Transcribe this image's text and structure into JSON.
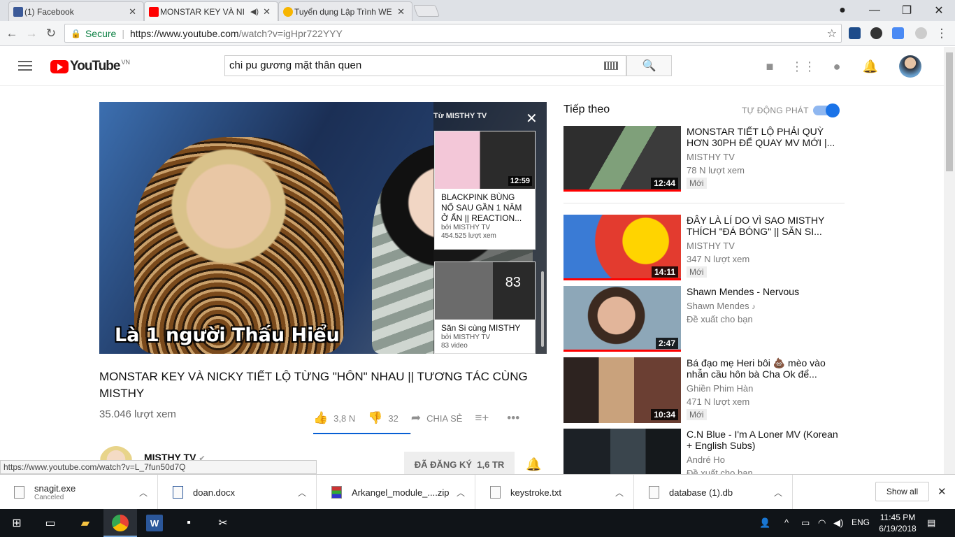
{
  "browser": {
    "tabs": [
      {
        "title": "(1) Facebook",
        "favicon_color": "#3b5998",
        "active": false
      },
      {
        "title": "MONSTAR KEY VÀ NI",
        "favicon_color": "#ff0000",
        "active": true
      },
      {
        "title": "Tuyển dụng Lập Trình WE",
        "favicon_color": "#f7b500",
        "active": false
      }
    ],
    "secure_label": "Secure",
    "url_host": "https://www.youtube.com",
    "url_path": "/watch?v=igHpr722YYY",
    "status_url": "https://www.youtube.com/watch?v=L_7fun50d7Q"
  },
  "youtube": {
    "logo_text": "YouTube",
    "country_code": "VN",
    "search_query": "chi pu gương mặt thân quen",
    "video": {
      "caption": "Là 1 người Thấu Hiểu",
      "title": "MONSTAR KEY VÀ NICKY TIẾT LỘ TỪNG \"HÔN\" NHAU || TƯƠNG TÁC CÙNG MISTHY",
      "views": "35.046 lượt xem",
      "likes": "3,8 N",
      "dislikes": "32",
      "share_label": "CHIA SẺ",
      "like_ratio": 0.99,
      "channel": "MISTHY TV",
      "subscribe_label": "ĐÃ ĐĂNG KÝ",
      "subscribers": "1,6 TR"
    },
    "endscreen": {
      "header": "Từ MISTHY TV",
      "cards": [
        {
          "title": "BLACKPINK BÙNG NỔ SAU GẦN 1 NĂM Ở ẨN || REACTION...",
          "by": "bởi MISTHY TV",
          "meta": "454.525 lượt xem",
          "duration": "12:59"
        },
        {
          "title": "Săn Si cùng MISTHY",
          "by": "bởi MISTHY TV",
          "meta": "83 video",
          "count": "83"
        }
      ]
    },
    "sidebar": {
      "up_next": "Tiếp theo",
      "autoplay_label": "TỰ ĐỘNG PHÁT",
      "autoplay_on": true,
      "items": [
        {
          "title": "MONSTAR TIẾT LỘ PHẢI QUỲ HƠN 30PH ĐỂ QUAY MV MỚI |...",
          "channel": "MISTHY TV",
          "views": "78 N lượt xem",
          "badge": "Mới",
          "duration": "12:44",
          "watched": 1.0
        },
        {
          "title": "ĐÂY LÀ LÍ DO VÌ SAO MISTHY THÍCH \"ĐÁ BÓNG\" || SĂN SI...",
          "channel": "MISTHY TV",
          "views": "347 N lượt xem",
          "badge": "Mới",
          "duration": "14:11",
          "watched": 1.0
        },
        {
          "title": "Shawn Mendes - Nervous",
          "channel": "Shawn Mendes",
          "views": "Đề xuất cho bạn",
          "badge": "",
          "duration": "2:47",
          "watched": 1.0
        },
        {
          "title": "Bá đạo mẹ Heri bôi 💩 mèo vào nhẫn cầu hôn bà Cha Ok để...",
          "channel": "Ghiền Phim Hàn",
          "views": "471 N lượt xem",
          "badge": "Mới",
          "duration": "10:34",
          "watched": 0.0
        },
        {
          "title": "C.N Blue - I'm A Loner MV (Korean + English Subs)",
          "channel": "André Ho",
          "views": "Đề xuất cho bạn",
          "badge": "",
          "duration": "",
          "watched": 0.0
        }
      ]
    }
  },
  "downloads": {
    "items": [
      {
        "name": "snagit.exe",
        "status": "Canceled"
      },
      {
        "name": "doan.docx",
        "status": ""
      },
      {
        "name": "Arkangel_module_....zip",
        "status": ""
      },
      {
        "name": "keystroke.txt",
        "status": ""
      },
      {
        "name": "database (1).db",
        "status": ""
      }
    ],
    "show_all": "Show all"
  },
  "taskbar": {
    "language": "ENG",
    "time": "11:45 PM",
    "date": "6/19/2018"
  }
}
